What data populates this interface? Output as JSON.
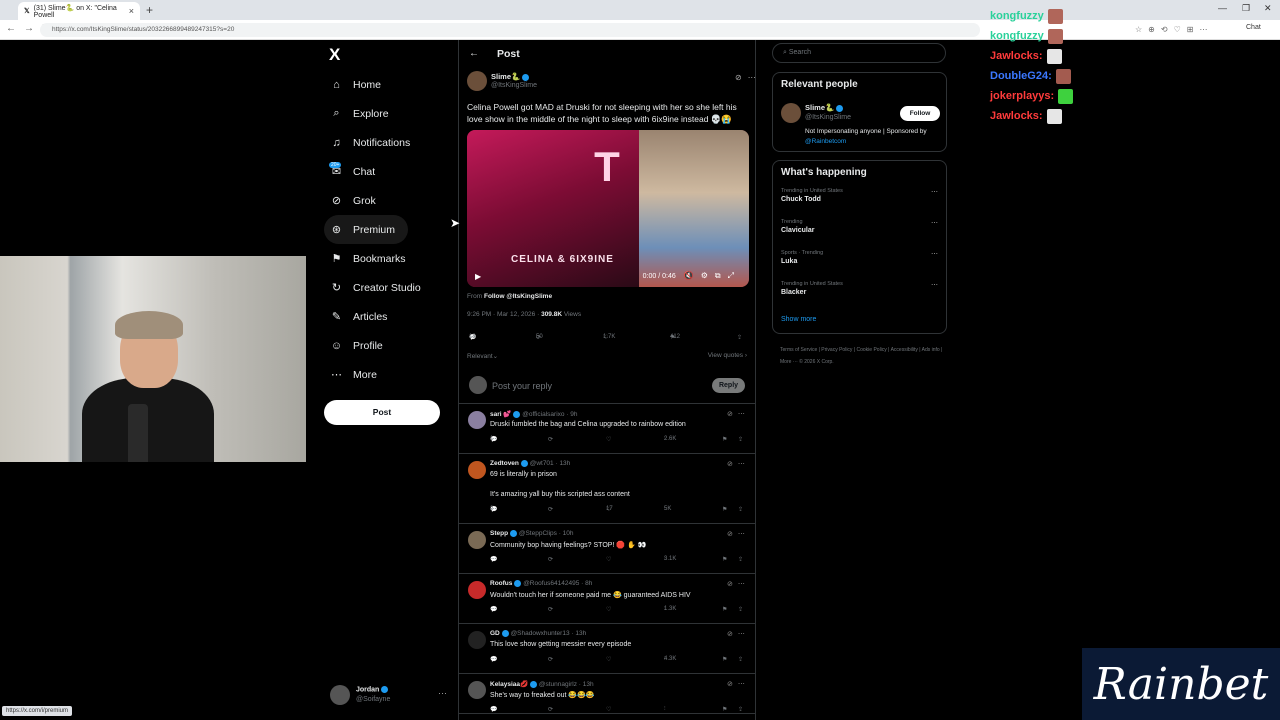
{
  "browser": {
    "tab_title": "(31) Slime🐍 on X: \"Celina Powell",
    "tab_close": "×",
    "new_tab": "+",
    "url": "https://x.com/ItsKingSlime/status/2032266899489247315?s=20",
    "chat_label": "Chat",
    "status_link": "https://x.com/i/premium"
  },
  "nav": {
    "logo": "X",
    "items": [
      {
        "label": "Home",
        "icon": "⌂",
        "icon_name": "home-icon"
      },
      {
        "label": "Explore",
        "icon": "⌕",
        "icon_name": "search-icon"
      },
      {
        "label": "Notifications",
        "icon": "♫",
        "icon_name": "bell-icon"
      },
      {
        "label": "Chat",
        "icon": "✉",
        "icon_name": "chat-icon",
        "badge": "20+"
      },
      {
        "label": "Grok",
        "icon": "⊘",
        "icon_name": "grok-icon"
      },
      {
        "label": "Premium",
        "icon": "⊛",
        "icon_name": "premium-icon",
        "active": true
      },
      {
        "label": "Bookmarks",
        "icon": "⚑",
        "icon_name": "bookmark-icon"
      },
      {
        "label": "Creator Studio",
        "icon": "↻",
        "icon_name": "creator-studio-icon"
      },
      {
        "label": "Articles",
        "icon": "✎",
        "icon_name": "articles-icon"
      },
      {
        "label": "Profile",
        "icon": "☺",
        "icon_name": "profile-icon"
      },
      {
        "label": "More",
        "icon": "⋯",
        "icon_name": "more-icon"
      }
    ],
    "post_button": "Post",
    "me": {
      "name": "Jordan",
      "handle": "@Soifayne",
      "dots": "···"
    }
  },
  "main": {
    "header": "Post",
    "author": {
      "name": "Slime🐍",
      "handle": "@ItsKingSlime"
    },
    "text": "Celina Powell got MAD at Druski for not sleeping with her so she left his love show in the middle of the night to sleep with 6ix9ine instead 💀😭",
    "media": {
      "caption": "CELINA & 6IX9INE",
      "time": "0:00 / 0:46"
    },
    "from_prefix": "From",
    "from_link": "Follow @ItsKingSlime",
    "timestamp": "9:26 PM · Mar 12, 2026 ·",
    "views": "309.8K",
    "views_label": "Views",
    "stats": {
      "replies": "18",
      "reposts": "50",
      "likes": "1.7K",
      "bookmarks": "412"
    },
    "sort": "Relevant",
    "view_quotes": "View quotes ›",
    "reply_placeholder": "Post your reply",
    "reply_button": "Reply",
    "replies": [
      {
        "name": "sari 💕",
        "handle": "@officialsarixo · 9h",
        "lines": [
          "Druski fumbled the bag and Celina upgraded to rainbow edition"
        ],
        "replies": "1",
        "likes": "",
        "views": "2.6K",
        "color": "#8a7fa0"
      },
      {
        "name": "Zedtoven",
        "handle": "@wt701 · 13h",
        "lines": [
          "69 is literally in prison",
          "",
          "It's amazing yall buy this scripted ass content"
        ],
        "replies": "2",
        "likes": "17",
        "views": "5K",
        "color": "#c0561f"
      },
      {
        "name": "Stepp",
        "handle": "@SteppClips · 10h",
        "lines": [
          "Community bop having feelings? STOP! 🛑 ✋ 👀"
        ],
        "replies": "",
        "likes": "",
        "views": "3.1K",
        "color": "#7a6a55"
      },
      {
        "name": "Roofus",
        "handle": "@Roofus64142495 · 8h",
        "lines": [
          "Wouldn't touch her if someone paid me 😂 guaranteed AIDS HIV"
        ],
        "replies": "",
        "likes": "",
        "views": "1.3K",
        "color": "#c72a2a"
      },
      {
        "name": "GD",
        "handle": "@Shadowxhunter13 · 13h",
        "lines": [
          "This love show getting messier every episode"
        ],
        "replies": "",
        "likes": "",
        "views": "4.3K",
        "color": "#222"
      },
      {
        "name": "Kelaysiaa💋",
        "handle": "@stunnagirlz · 13h",
        "lines": [
          "She's way to freaked out 😂😂😂"
        ],
        "replies": "",
        "likes": "",
        "views": "",
        "color": "#555"
      }
    ]
  },
  "right": {
    "search_placeholder": "Search",
    "relevant_title": "Relevant people",
    "rp": {
      "name": "Slime🐍",
      "handle": "@ItsKingSlime",
      "follow": "Follow",
      "bio": "Not Impersonating anyone | Sponsored by",
      "bio_link": "@Rainbetcom"
    },
    "happening_title": "What's happening",
    "trends": [
      {
        "ctx": "Trending in United States",
        "name": "Chuck Todd"
      },
      {
        "ctx": "Trending",
        "name": "Clavicular"
      },
      {
        "ctx": "Sports · Trending",
        "name": "Luka"
      },
      {
        "ctx": "Trending in United States",
        "name": "Blacker"
      }
    ],
    "show_more": "Show more",
    "footer": "Terms of Service  |  Privacy Policy  |  Cookie Policy  |  Accessibility  |  Ads info  |  More ···  © 2026 X Corp."
  },
  "stream_chat": [
    {
      "user": "kongfuzzy",
      "color": "#2ad19a",
      "emote": "#b0665a"
    },
    {
      "user": "kongfuzzy",
      "color": "#2ad19a",
      "emote": "#b0665a"
    },
    {
      "user": "Jawlocks:",
      "color": "#ff3b3b",
      "emote": "#e6e6e6"
    },
    {
      "user": "DoubleG24:",
      "color": "#3b78ff",
      "emote": "#a35b4f"
    },
    {
      "user": "jokerplayys:",
      "color": "#ff3b3b",
      "emote": "#3ed13e"
    },
    {
      "user": "Jawlocks:",
      "color": "#ff3b3b",
      "emote": "#e6e6e6"
    }
  ],
  "rainbet": "Rainbet"
}
